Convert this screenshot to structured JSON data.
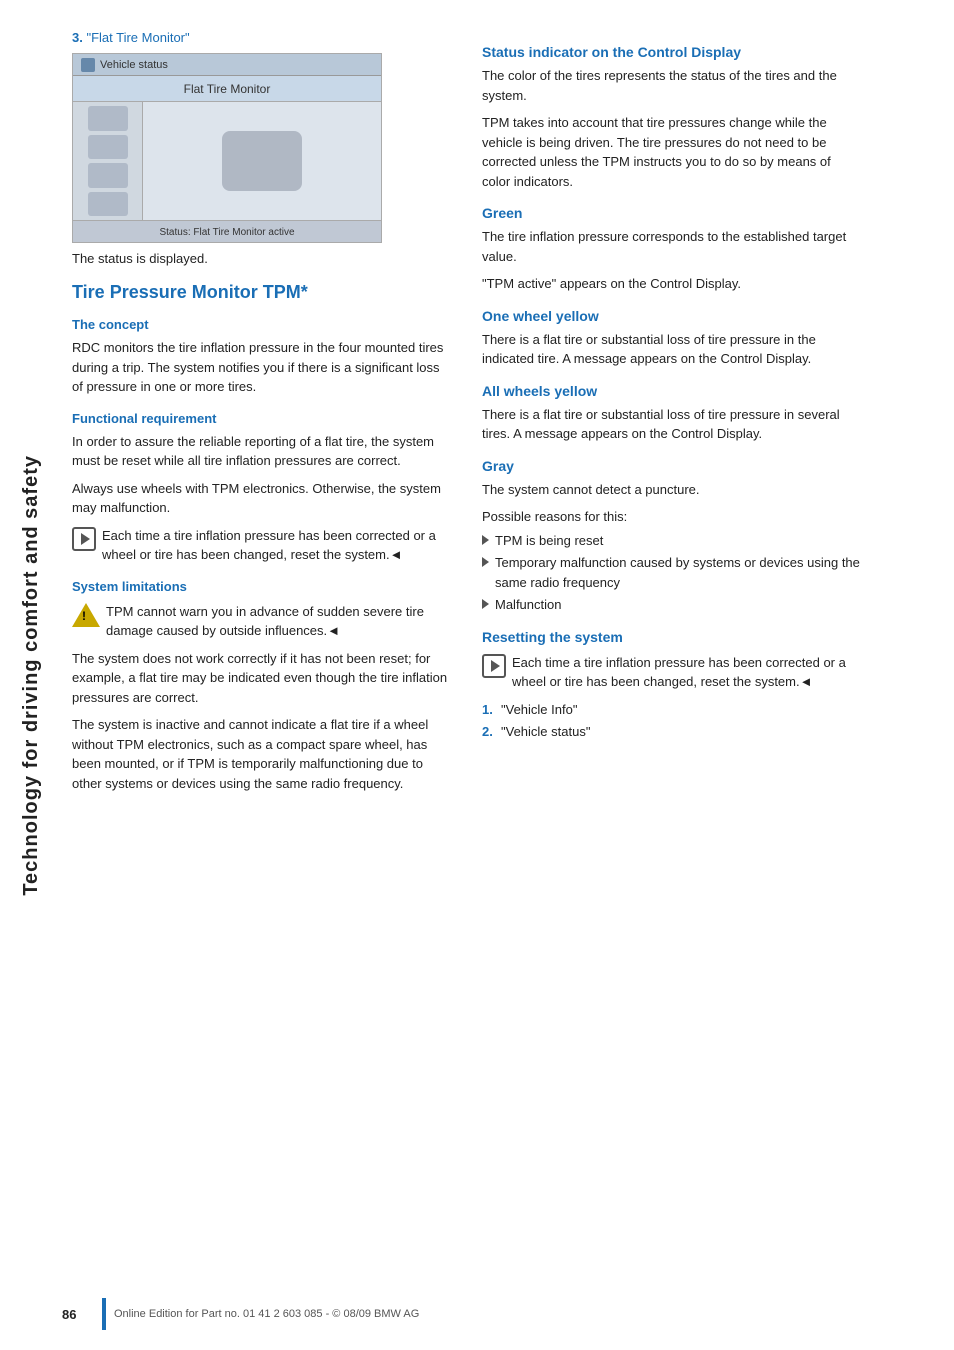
{
  "sidebar": {
    "text": "Technology for driving comfort and safety"
  },
  "left_col": {
    "step3": {
      "number": "3.",
      "label": "\"Flat Tire Monitor\"",
      "screenshot": {
        "header_label": "Vehicle status",
        "menu_label": "Flat Tire Monitor",
        "footer_label": "Status: Flat Tire Monitor active"
      },
      "status_text": "The status is displayed."
    },
    "main_section": {
      "title": "Tire Pressure Monitor TPM*",
      "subsections": [
        {
          "id": "the-concept",
          "title": "The concept",
          "body": "RDC monitors the tire inflation pressure in the four mounted tires during a trip. The system notifies you if there is a significant loss of pressure in one or more tires."
        },
        {
          "id": "functional-requirement",
          "title": "Functional requirement",
          "body1": "In order to assure the reliable reporting of a flat tire, the system must be reset while all tire inflation pressures are correct.",
          "body2": "Always use wheels with TPM electronics. Otherwise, the system may malfunction.",
          "note": "Each time a tire inflation pressure has been corrected or a wheel or tire has been changed, reset the system.◄"
        },
        {
          "id": "system-limitations",
          "title": "System limitations",
          "warning": "TPM cannot warn you in advance of sudden severe tire damage caused by outside influences.◄",
          "body1": "The system does not work correctly if it has not been reset; for example, a flat tire may be indicated even though the tire inflation pressures are correct.",
          "body2": "The system is inactive and cannot indicate a flat tire if a wheel without TPM electronics, such as a compact spare wheel, has been mounted, or if TPM is temporarily malfunctioning due to other systems or devices using the same radio frequency."
        }
      ]
    }
  },
  "right_col": {
    "sections": [
      {
        "id": "status-indicator",
        "title": "Status indicator on the Control Display",
        "body1": "The color of the tires represents the status of the tires and the system.",
        "body2": "TPM takes into account that tire pressures change while the vehicle is being driven. The tire pressures do not need to be corrected unless the TPM instructs you to do so by means of color indicators."
      },
      {
        "id": "green",
        "title": "Green",
        "body1": "The tire inflation pressure corresponds to the established target value.",
        "body2": "\"TPM active\" appears on the Control Display."
      },
      {
        "id": "one-wheel-yellow",
        "title": "One wheel yellow",
        "body": "There is a flat tire or substantial loss of tire pressure in the indicated tire. A message appears on the Control Display."
      },
      {
        "id": "all-wheels-yellow",
        "title": "All wheels yellow",
        "body": "There is a flat tire or substantial loss of tire pressure in several tires. A message appears on the Control Display."
      },
      {
        "id": "gray",
        "title": "Gray",
        "body": "The system cannot detect a puncture.",
        "sub_label": "Possible reasons for this:",
        "bullets": [
          "TPM is being reset",
          "Temporary malfunction caused by systems or devices using the same radio frequency",
          "Malfunction"
        ]
      },
      {
        "id": "resetting-the-system",
        "title": "Resetting the system",
        "note": "Each time a tire inflation pressure has been corrected or a wheel or tire has been changed, reset the system.◄",
        "steps": [
          "\"Vehicle Info\"",
          "\"Vehicle status\""
        ]
      }
    ]
  },
  "footer": {
    "page_number": "86",
    "text": "Online Edition for Part no. 01 41 2 603 085 - © 08/09 BMW AG"
  }
}
